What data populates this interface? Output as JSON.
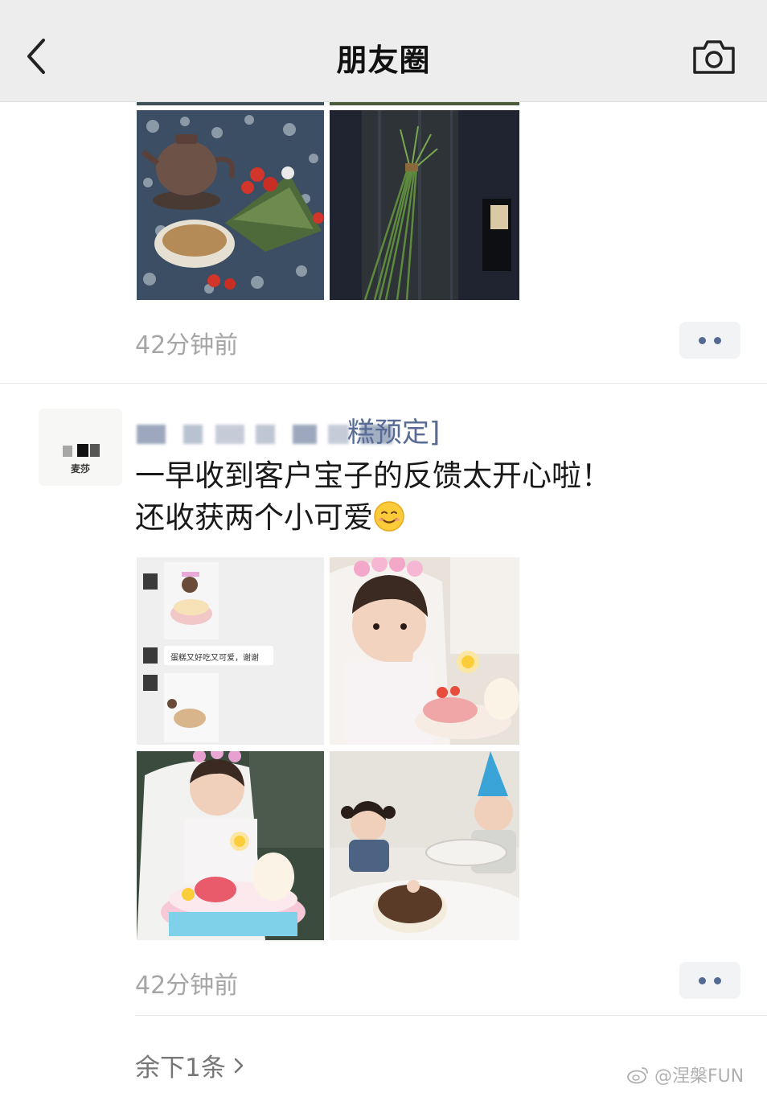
{
  "header": {
    "title": "朋友圈"
  },
  "post1": {
    "timestamp": "42分钟前"
  },
  "post2": {
    "avatar_label": "麦莎",
    "name_suffix": "糕预定]",
    "text_line1": "一早收到客户宝子的反馈太开心啦！",
    "text_line2": "还收获两个小可爱",
    "emoji": "smiling-face-emoji",
    "chat_bubble_text": "蛋糕又好吃又可爱，谢谢",
    "timestamp": "42分钟前"
  },
  "footer": {
    "remaining_label": "余下1条",
    "watermark": "@涅槃FUN"
  },
  "colors": {
    "header_bg": "#ededed",
    "name_link": "#576b95",
    "timestamp": "#a6a6a6",
    "more_dots": "#536a92"
  }
}
